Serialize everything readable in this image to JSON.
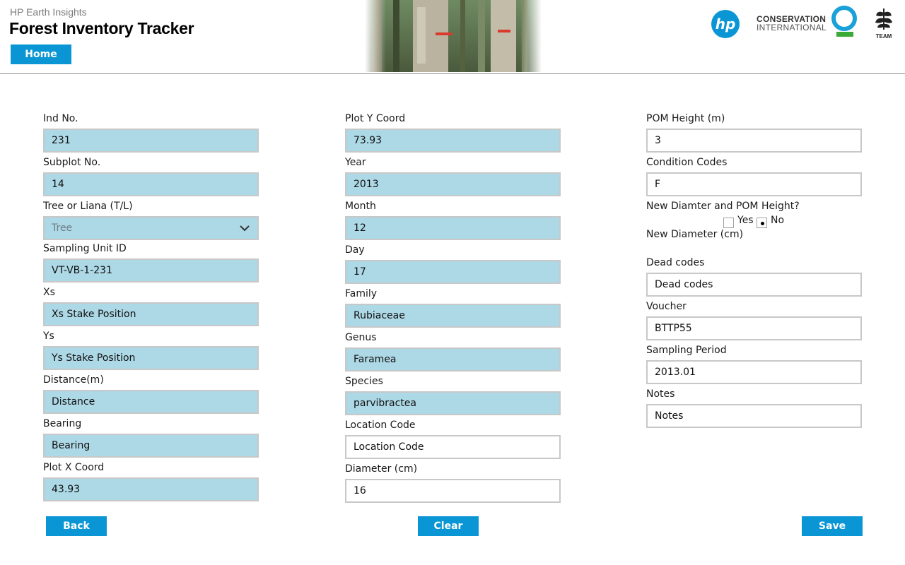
{
  "header": {
    "subtitle": "HP Earth Insights",
    "title": "Forest Inventory Tracker",
    "home_label": "Home",
    "ci_line1": "CONSERVATION",
    "ci_line2": "INTERNATIONAL",
    "team_label": "TEAM",
    "hp_label": "hp"
  },
  "form": {
    "ind_no": {
      "label": "Ind No.",
      "value": "231"
    },
    "subplot_no": {
      "label": "Subplot No.",
      "value": "14"
    },
    "tree_or_liana": {
      "label": "Tree or Liana (T/L)",
      "value": "Tree"
    },
    "sampling_unit_id": {
      "label": "Sampling Unit ID",
      "value": "VT-VB-1-231"
    },
    "xs": {
      "label": "Xs",
      "value": "Xs Stake Position"
    },
    "ys": {
      "label": "Ys",
      "value": "Ys Stake Position"
    },
    "distance": {
      "label": "Distance(m)",
      "value": "Distance"
    },
    "bearing": {
      "label": "Bearing",
      "value": "Bearing"
    },
    "plot_x": {
      "label": "Plot X Coord",
      "value": "43.93"
    },
    "plot_y": {
      "label": "Plot Y Coord",
      "value": "73.93"
    },
    "year": {
      "label": "Year",
      "value": "2013"
    },
    "month": {
      "label": "Month",
      "value": "12"
    },
    "day": {
      "label": "Day",
      "value": "17"
    },
    "family": {
      "label": "Family",
      "value": "Rubiaceae"
    },
    "genus": {
      "label": "Genus",
      "value": "Faramea"
    },
    "species": {
      "label": "Species",
      "value": "parvibractea"
    },
    "location_code": {
      "label": "Location Code",
      "value": "Location Code"
    },
    "diameter": {
      "label": "Diameter (cm)",
      "value": "16"
    },
    "pom_height": {
      "label": "POM Height (m)",
      "value": "3"
    },
    "condition_codes": {
      "label": "Condition Codes",
      "value": "F"
    },
    "new_diameter_question": {
      "label": "New Diamter and POM Height?",
      "yes_label": "Yes",
      "no_label": "No",
      "selected": "No"
    },
    "new_diameter": {
      "label": "New Diameter (cm)"
    },
    "dead_codes": {
      "label": "Dead codes",
      "value": "Dead codes"
    },
    "voucher": {
      "label": "Voucher",
      "value": "BTTP55"
    },
    "sampling_period": {
      "label": "Sampling Period",
      "value": "2013.01"
    },
    "notes": {
      "label": "Notes",
      "value": "Notes"
    }
  },
  "buttons": {
    "back": "Back",
    "clear": "Clear",
    "save": "Save"
  },
  "colors": {
    "accent": "#0a96d4",
    "field_filled": "#add8e6",
    "ci_green": "#3aa935",
    "ci_blue": "#1aa1d8"
  }
}
